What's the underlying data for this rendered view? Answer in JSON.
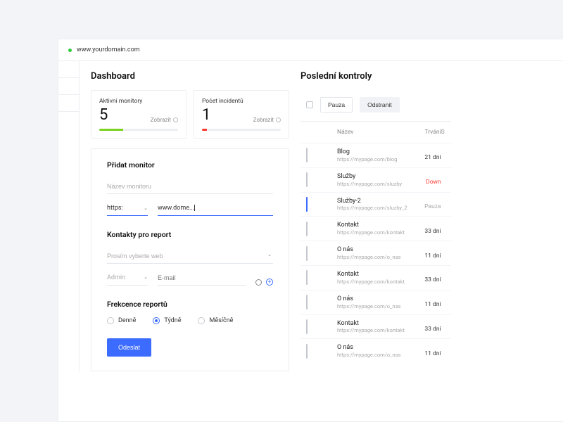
{
  "url": "www.yourdomain.com",
  "dashboard": {
    "title": "Dashboard",
    "stats": {
      "monitors": {
        "label": "Aktivní monitory",
        "value": "5",
        "link": "Zobrazit"
      },
      "incidents": {
        "label": "Počet incidentů",
        "value": "1",
        "link": "Zobrazit"
      }
    },
    "add_monitor": {
      "title": "Přidat monitor",
      "name_placeholder": "Název monitoru",
      "protocol": "https:",
      "domain_value": "www.dome..."
    },
    "contacts": {
      "title": "Kontakty pro report",
      "web_placeholder": "Prosím vyberte web",
      "role_placeholder": "Admin",
      "email_placeholder": "E-mail"
    },
    "frequency": {
      "title": "Frekcence reportů",
      "options": [
        "Denně",
        "Týdně",
        "Měsíčně"
      ],
      "selected": 1
    },
    "submit": "Odeslat"
  },
  "checks": {
    "title": "Poslední kontroly",
    "actions": {
      "pause": "Pauza",
      "remove": "Odstranit"
    },
    "columns": {
      "name": "Název",
      "duration": "Trvání",
      "status": "S"
    },
    "rows": [
      {
        "status": "blue",
        "name": "Blog",
        "url": "https://mypage.com/blog",
        "duration": "21 dní",
        "seg": "blue",
        "checked": false
      },
      {
        "status": "red",
        "name": "Služby",
        "url": "https://mypage.com/sluzby",
        "duration": "Down",
        "seg": "red",
        "checked": false,
        "down": true
      },
      {
        "status": "grey",
        "name": "Služby-2",
        "url": "https://mypage.com/sluzby_2",
        "duration": "Pauza",
        "seg": "",
        "checked": true,
        "pause": true
      },
      {
        "status": "blue",
        "name": "Kontakt",
        "url": "https://mypage.com/kontakt",
        "duration": "33 dní",
        "seg": "blue",
        "checked": false
      },
      {
        "status": "blue",
        "name": "O nás",
        "url": "https://mypage.com/o_nas",
        "duration": "11 dní",
        "seg": "blue",
        "checked": false
      },
      {
        "status": "blue",
        "name": "Kontakt",
        "url": "https://mypage.com/kontakt",
        "duration": "33 dní",
        "seg": "blue",
        "checked": false
      },
      {
        "status": "blue",
        "name": "O nás",
        "url": "https://mypage.com/o_nas",
        "duration": "11 dní",
        "seg": "blue",
        "checked": false
      },
      {
        "status": "blue",
        "name": "Kontakt",
        "url": "https://mypage.com/kontakt",
        "duration": "33 dní",
        "seg": "blue",
        "checked": false
      },
      {
        "status": "blue",
        "name": "O nás",
        "url": "https://mypage.com/o_nas",
        "duration": "11 dní",
        "seg": "blue",
        "checked": false
      }
    ]
  }
}
